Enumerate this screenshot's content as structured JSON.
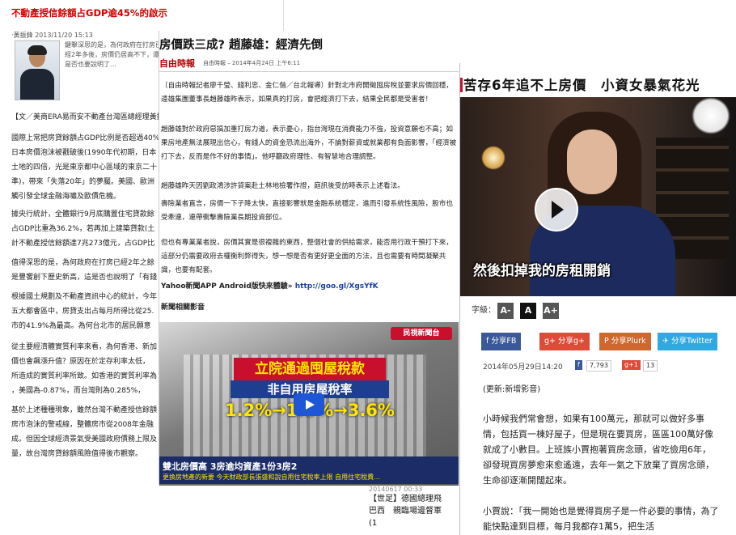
{
  "left_article": {
    "title": "不動產授信餘額占GDP逾45%的啟示",
    "meta": "·黃振鋒 2013/11/20 15:13",
    "intro": "鍵擊深思的是，為何政府在打房已經2年多後，房價仍居高不下，還是否也要說明了…",
    "paragraphs": [
      "【文／美商ERA易而安不動產台灣區總經理黃振鋒】",
      "國際上常把房貸餘額占GDP比例是否超過40%",
      "日本房價泡沫被戳破後(1990年代初期，日本",
      "土地的四倍，光是東京都中心區域的東京二十",
      "準)，帶來「失落20年」的夢魘。美國、歐洲",
      "觸引發全球金融海嘯及歐債危機。",
      "據央行統計，全體銀行9月底購置住宅貸款餘",
      "占GDP比重為36.2%，若再加上建築貸款(土",
      "計不動產授信餘額達7兆273億元，占GDP比",
      "值得深思的是，為何政府在打房已經2年之餘",
      "是豐饗創下歷史新高，這是否也說明了「有錢",
      "根據國土規劃及不動產資訊中心的統計，今年",
      "五大都會區中，房貸支出占每月所得比從25.",
      "市的41.9%為最高。為何台北市的居民願意",
      "從主要經濟體實質利率來看，為何香港、新加",
      "價也會飆漲升值？原因在於定存利率太低，",
      "所造成的實質利率所致。如香港的實質利率為",
      "，美國為-0.87%，而台灣則為0.285%，",
      "基於上述種種現象，雖然台灣不動產授信餘額",
      "房市泡沫的警戒線，整體房市從2008年金融",
      "成。但因全球經濟景氣受美國政府債務上限及",
      "量，故台灣房貸餘額風險值得後市觀察。"
    ],
    "bottom": {
      "date": "20140617 00:33",
      "line1": "【世足】德國總理飛",
      "line2": "巴西　親臨場邊督軍",
      "line3": "(1"
    }
  },
  "mid_article": {
    "headline": "房價跌三成? 趙藤雄：經濟先倒",
    "source": "自由時報",
    "source_date": "自由時報 – 2014年4月24日 上午6:11",
    "paragraphs": [
      "〔自由時報記者廖千瑩、錢利忠、金仁偕／台北報導〕針對北市府開徵囤房稅並要求房價回穩，遠雄集團董事長趙藤雄昨表示，如果真的打房，會把經濟打下去，結果全民都是受害者！",
      "趙藤雄對於政府惡搞加重打房力道，表示憂心，指台灣現在消費能力不強，投資意願也不高；如果房地產無法展現出信心，有錢人的資金恐流出海外，不論對薪資或就業都有負面影響，「經濟被打下去，反而是作不好的事情」。他呼籲政府理性、有智慧地合理調整。",
      "趙藤雄昨天因劉政鴻涉許貸案赴土林地檢署作證，庭訊後受訪時表示上述看法。",
      "壽險業者直言，房價一下子降太快，直接影響就是金融系統穩定，進而引發系統性風險，股市也受牽連，連帶衝擊壽險業長期投資部位。",
      "但也有專業業者說，房價其實是很複雜的東西，整個社會的供給需求，能否用行政干預打下來，這部分仍需要政府去權衡利弊得失，想一想是否有更好更全面的方法，且也需要有時間凝聚共識，也要有配套。"
    ],
    "yahoo_label": "Yahoo新聞APP Android版快來體驗»",
    "yahoo_link": "http://goo.gl/XgsYfK",
    "related": "新聞相關影音",
    "video": {
      "channel": "民視新聞台",
      "cap1": "立院通過囤屋稅款",
      "cap2": "非自用房屋稅率",
      "cap3": "1.2%→1.5%→3.6%",
      "ticker1": "雙北房價高 3房逾均資產1份3房2",
      "ticker2": "更換房地產的新要 今天財政部長張盛和說自用住宅稅率上限 自用住宅稅費…"
    }
  },
  "right_article": {
    "headline": "苦存6年追不上房價　小資女暴氣花光",
    "video_subtitle": "然後扣掉我的房租開銷",
    "font_label": "字級：",
    "font_buttons": [
      "A-",
      "A",
      "A+"
    ],
    "share": [
      "分享FB",
      "分享g+",
      "分享Plurk",
      "分享Twitter"
    ],
    "date": "2014年05月29日14:20",
    "fb_count": "7,793",
    "gplus_count": "13",
    "update": "(更新:新增影音)",
    "paragraphs": [
      "小時候我們常會想，如果有100萬元，那就可以做好多事情，包括買一棟好屋子，但是現在要買房，區區100萬好像就成了小數目。上班族小賈抱著買房念頭，省吃儉用6年，卻發現買房夢愈來愈遙遠，去年一氣之下放棄了買房念頭，生命卻逐漸開闊起來。",
      "小賈說：「我一開始也是覺得買房子是一件必要的事情，為了能快點達到目標，每月我都存1萬5，把生活"
    ],
    "colors": {
      "fb": "#3b5998",
      "gplus": "#dd4b39",
      "plurk": "#cf682f",
      "twitter": "#2fa9e0"
    }
  }
}
